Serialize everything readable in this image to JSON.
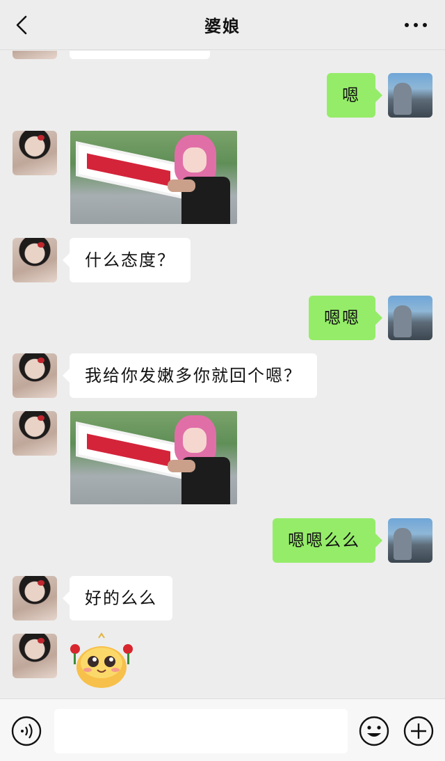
{
  "header": {
    "title": "婆娘",
    "back_icon": "chevron-left-icon",
    "more_icon": "more-dots-icon"
  },
  "messages": [
    {
      "side": "right",
      "type": "text",
      "text": "嗯"
    },
    {
      "side": "left",
      "type": "sticker",
      "sticker": "anime-girl-sword-sticker"
    },
    {
      "side": "left",
      "type": "text",
      "text": "什么态度？"
    },
    {
      "side": "right",
      "type": "text",
      "text": "嗯嗯"
    },
    {
      "side": "left",
      "type": "text",
      "text": "我给你发嫩多你就回个嗯？"
    },
    {
      "side": "left",
      "type": "sticker",
      "sticker": "anime-girl-sword-sticker"
    },
    {
      "side": "right",
      "type": "text",
      "text": "嗯嗯么么"
    },
    {
      "side": "left",
      "type": "text",
      "text": "好的么么"
    },
    {
      "side": "left",
      "type": "sticker",
      "sticker": "smiling-face-roses-sticker"
    }
  ],
  "bottom_bar": {
    "voice_icon": "voice-icon",
    "input_value": "",
    "emoji_icon": "emoji-icon",
    "plus_icon": "plus-icon"
  },
  "colors": {
    "background": "#ededed",
    "bubble_self": "#95ec69",
    "bubble_other": "#ffffff"
  }
}
